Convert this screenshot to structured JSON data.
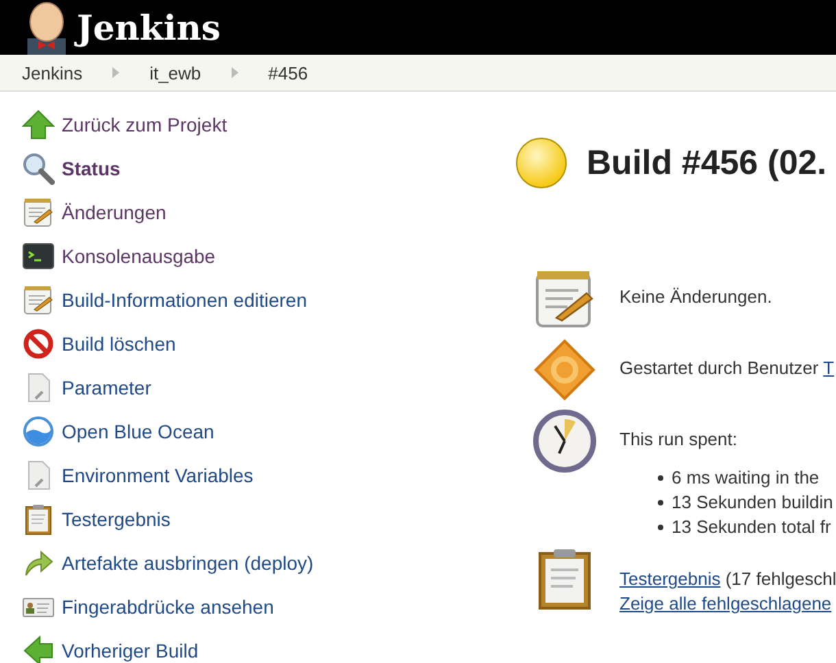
{
  "header": {
    "title": "Jenkins"
  },
  "breadcrumbs": [
    "Jenkins",
    "it_ewb",
    "#456"
  ],
  "sidebar": {
    "items": [
      {
        "kind": "up-arrow",
        "label": "Zurück zum Projekt",
        "visited": true,
        "selected": false
      },
      {
        "kind": "search",
        "label": "Status",
        "visited": true,
        "selected": true
      },
      {
        "kind": "notepad",
        "label": "Änderungen",
        "visited": true,
        "selected": false
      },
      {
        "kind": "terminal",
        "label": "Konsolenausgabe",
        "visited": true,
        "selected": false
      },
      {
        "kind": "notepad",
        "label": "Build-Informationen editieren",
        "visited": false,
        "selected": false
      },
      {
        "kind": "no",
        "label": "Build löschen",
        "visited": false,
        "selected": false
      },
      {
        "kind": "document",
        "label": "Parameter",
        "visited": false,
        "selected": false
      },
      {
        "kind": "ocean",
        "label": "Open Blue Ocean",
        "visited": false,
        "selected": false
      },
      {
        "kind": "document",
        "label": "Environment Variables",
        "visited": false,
        "selected": false
      },
      {
        "kind": "clipboard",
        "label": "Testergebnis",
        "visited": false,
        "selected": false
      },
      {
        "kind": "redo",
        "label": "Artefakte ausbringen (deploy)",
        "visited": false,
        "selected": false
      },
      {
        "kind": "card",
        "label": "Fingerabdrücke ansehen",
        "visited": false,
        "selected": false
      },
      {
        "kind": "left-arrow",
        "label": "Vorheriger Build",
        "visited": false,
        "selected": false
      }
    ]
  },
  "build": {
    "title": "Build #456 (02."
  },
  "summary": [
    {
      "kind": "notepad",
      "text": "Keine Änderungen."
    },
    {
      "kind": "gear",
      "text": "Gestartet durch Benutzer",
      "link": "T"
    },
    {
      "kind": "clock",
      "text": "This run spent:",
      "bullets": [
        "6 ms waiting in the",
        "13 Sekunden buildin",
        "13 Sekunden total fr"
      ]
    },
    {
      "kind": "clipboard",
      "link": "Testergebnis",
      "text": "(17 fehlgeschl",
      "link2": "Zeige alle fehlgeschlagene"
    }
  ]
}
